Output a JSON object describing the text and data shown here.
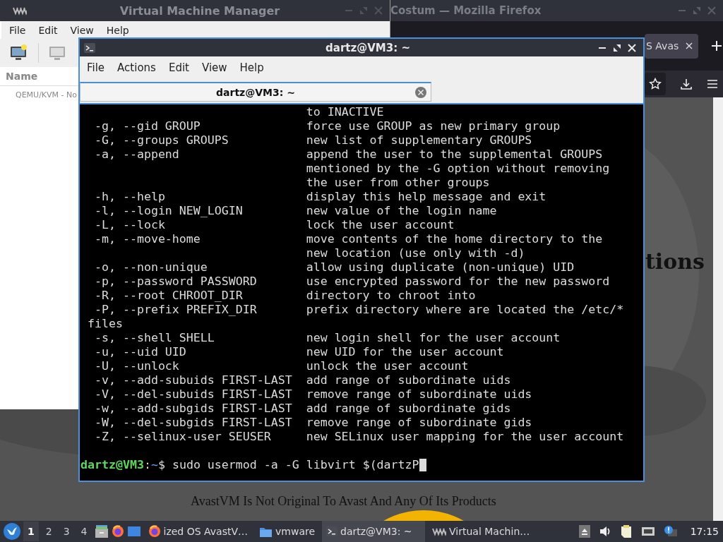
{
  "browser_window": {
    "title": "Costum — Mozilla Firefox",
    "tabs": [
      {
        "label": "S Avas",
        "selected": true
      }
    ],
    "page": {
      "heading": "tions",
      "footer": "AvastVM Is Not Original To Avast And Any Of Its Products"
    }
  },
  "vmm_window": {
    "title": "Virtual Machine Manager",
    "menu": [
      "File",
      "Edit",
      "View",
      "Help"
    ],
    "column_header": "Name",
    "connections": [
      "QEMU/KVM - No"
    ]
  },
  "terminal_window": {
    "title": "dartz@VM3: ~",
    "menu": [
      "File",
      "Actions",
      "Edit",
      "View",
      "Help"
    ],
    "tabs": [
      {
        "label": "dartz@VM3: ~",
        "selected": true
      }
    ],
    "lines": [
      {
        "kind": "continuation",
        "description": "to INACTIVE"
      },
      {
        "kind": "option",
        "option": "-g, --gid GROUP",
        "description": "force use GROUP as new primary group"
      },
      {
        "kind": "option",
        "option": "-G, --groups GROUPS",
        "description": "new list of supplementary GROUPS"
      },
      {
        "kind": "option",
        "option": "-a, --append",
        "description": "append the user to the supplemental GROUPS"
      },
      {
        "kind": "continuation",
        "description": "mentioned by the -G option without removing"
      },
      {
        "kind": "continuation",
        "description": "the user from other groups"
      },
      {
        "kind": "option",
        "option": "-h, --help",
        "description": "display this help message and exit"
      },
      {
        "kind": "option",
        "option": "-l, --login NEW_LOGIN",
        "description": "new value of the login name"
      },
      {
        "kind": "option",
        "option": "-L, --lock",
        "description": "lock the user account"
      },
      {
        "kind": "option",
        "option": "-m, --move-home",
        "description": "move contents of the home directory to the"
      },
      {
        "kind": "continuation",
        "description": "new location (use only with -d)"
      },
      {
        "kind": "option",
        "option": "-o, --non-unique",
        "description": "allow using duplicate (non-unique) UID"
      },
      {
        "kind": "option",
        "option": "-p, --password PASSWORD",
        "description": "use encrypted password for the new password"
      },
      {
        "kind": "option",
        "option": "-R, --root CHROOT_DIR",
        "description": "directory to chroot into"
      },
      {
        "kind": "option",
        "option": "-P, --prefix PREFIX_DIR",
        "description": "prefix directory where are located the /etc/*"
      },
      {
        "kind": "wrap",
        "description": "files"
      },
      {
        "kind": "option",
        "option": "-s, --shell SHELL",
        "description": "new login shell for the user account"
      },
      {
        "kind": "option",
        "option": "-u, --uid UID",
        "description": "new UID for the user account"
      },
      {
        "kind": "option",
        "option": "-U, --unlock",
        "description": "unlock the user account"
      },
      {
        "kind": "option",
        "option": "-v, --add-subuids FIRST-LAST",
        "description": "add range of subordinate uids"
      },
      {
        "kind": "option",
        "option": "-V, --del-subuids FIRST-LAST",
        "description": "remove range of subordinate uids"
      },
      {
        "kind": "option",
        "option": "-w, --add-subgids FIRST-LAST",
        "description": "add range of subordinate gids"
      },
      {
        "kind": "option",
        "option": "-W, --del-subgids FIRST-LAST",
        "description": "remove range of subordinate gids"
      },
      {
        "kind": "option",
        "option": "-Z, --selinux-user SEUSER",
        "description": "new SELinux user mapping for the user account"
      }
    ],
    "prompt": {
      "user_host": "dartz@VM3",
      "separator": ":",
      "path": "~",
      "symbol": "$",
      "command": "sudo usermod -a -G libvirt $(dartzP"
    }
  },
  "taskbar": {
    "workspaces": [
      {
        "label": "1",
        "selected": true
      },
      {
        "label": "2",
        "selected": false
      },
      {
        "label": "3",
        "selected": false
      },
      {
        "label": "4",
        "selected": false
      }
    ],
    "tasks": [
      {
        "kind": "browser",
        "label": "ized OS AvastV…",
        "selected": false
      },
      {
        "kind": "folder",
        "label": "vmware",
        "selected": false
      },
      {
        "kind": "terminal",
        "label": "dartz@VM3: ~",
        "selected": true
      },
      {
        "kind": "vmm",
        "label": "Virtual Machin…",
        "selected": false
      }
    ],
    "clock": "17:15"
  }
}
